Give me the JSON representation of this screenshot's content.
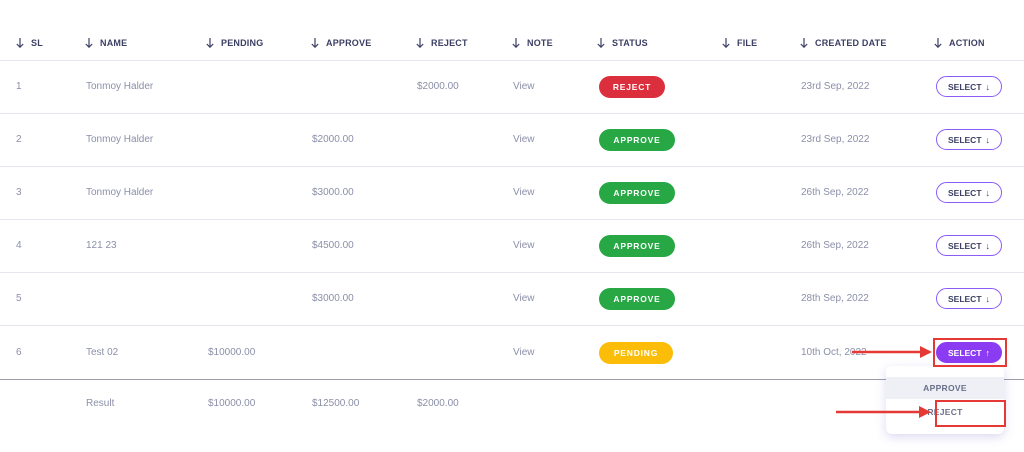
{
  "table": {
    "headers": {
      "sl": "SL",
      "name": "NAME",
      "pending": "PENDING",
      "approve": "APPROVE",
      "reject": "REJECT",
      "note": "NOTE",
      "status": "STATUS",
      "file": "FILE",
      "created_date": "CREATED DATE",
      "action": "ACTION"
    },
    "rows": [
      {
        "sl": "1",
        "name": "Tonmoy Halder",
        "pending": "",
        "approve": "",
        "reject": "$2000.00",
        "note": "View",
        "status": "REJECT",
        "created": "23rd Sep, 2022",
        "action": "SELECT"
      },
      {
        "sl": "2",
        "name": "Tonmoy Halder",
        "pending": "",
        "approve": "$2000.00",
        "reject": "",
        "note": "View",
        "status": "APPROVE",
        "created": "23rd Sep, 2022",
        "action": "SELECT"
      },
      {
        "sl": "3",
        "name": "Tonmoy Halder",
        "pending": "",
        "approve": "$3000.00",
        "reject": "",
        "note": "View",
        "status": "APPROVE",
        "created": "26th Sep, 2022",
        "action": "SELECT"
      },
      {
        "sl": "4",
        "name": "121 23",
        "pending": "",
        "approve": "$4500.00",
        "reject": "",
        "note": "View",
        "status": "APPROVE",
        "created": "26th Sep, 2022",
        "action": "SELECT"
      },
      {
        "sl": "5",
        "name": "",
        "pending": "",
        "approve": "$3000.00",
        "reject": "",
        "note": "View",
        "status": "APPROVE",
        "created": "28th Sep, 2022",
        "action": "SELECT"
      },
      {
        "sl": "6",
        "name": "Test 02",
        "pending": "$10000.00",
        "approve": "",
        "reject": "",
        "note": "View",
        "status": "PENDING",
        "created": "10th Oct, 2022",
        "action": "SELECT"
      }
    ],
    "result": {
      "label": "Result",
      "pending": "$10000.00",
      "approve": "$12500.00",
      "reject": "$2000.00"
    }
  },
  "dropdown": {
    "items": [
      "APPROVE",
      "REJECT"
    ]
  },
  "colors": {
    "reject": "#dc2f3e",
    "approve": "#28a745",
    "pending": "#fbbd08",
    "accent": "#8b3cf3",
    "highlight": "#e53935"
  },
  "icons": {
    "sort": "arrow-down-icon",
    "select": "arrow-down-icon",
    "select_active": "arrow-up-icon"
  }
}
